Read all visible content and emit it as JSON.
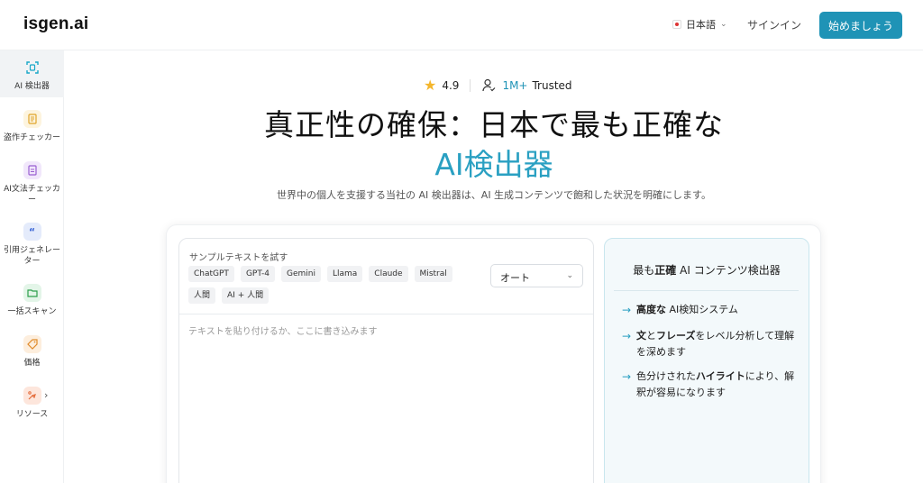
{
  "header": {
    "logo": "isgen.ai",
    "language": "日本語",
    "signin": "サインイン",
    "start": "始めましょう"
  },
  "sidebar": {
    "items": [
      {
        "label": "AI 検出器",
        "icon": "scan-icon",
        "color": "#19a7c8"
      },
      {
        "label": "盗作チェッカー",
        "icon": "document-icon",
        "color": "#e0a52a"
      },
      {
        "label": "AI文法チェッカー",
        "icon": "grammar-icon",
        "color": "#9a5fd1"
      },
      {
        "label": "引用ジェネレーター",
        "icon": "quote-icon",
        "color": "#3b66d6"
      },
      {
        "label": "一括スキャン",
        "icon": "folder-icon",
        "color": "#2d9f4c"
      },
      {
        "label": "価格",
        "icon": "tag-icon",
        "color": "#e08a2a"
      },
      {
        "label": "リソース",
        "icon": "resources-icon",
        "color": "#e46b3a"
      }
    ]
  },
  "hero": {
    "rating": "4.9",
    "trusted_count": "1M+",
    "trusted_label": "Trusted",
    "title_line1": "真正性の確保：日本で最も正確な",
    "title_line2": "AI検出器",
    "subtitle": "世界中の個人を支援する当社の AI 検出器は、AI 生成コンテンツで飽和した状況を明確にします。"
  },
  "editor": {
    "sample_title": "サンプルテキストを試す",
    "chips": [
      "ChatGPT",
      "GPT-4",
      "Gemini",
      "Llama",
      "Claude",
      "Mistral",
      "人間",
      "AI + 人間"
    ],
    "select_value": "オート",
    "placeholder": "テキストを貼り付けるか、ここに書き込みます"
  },
  "info": {
    "title_pre": "最も",
    "title_bold": "正確",
    "title_post": " AI コンテンツ検出器",
    "features": [
      {
        "bold": "高度な",
        "rest": " AI検知システム"
      },
      {
        "bold": "文",
        "mid": "と",
        "bold2": "フレーズ",
        "rest": "をレベル分析して理解を深めます"
      },
      {
        "pre": "色分けされた",
        "bold": "ハイライト",
        "rest": "により、解釈が容易になります"
      }
    ]
  },
  "colors": {
    "accent": "#1f93b6",
    "accent_light": "#2aa0c2",
    "star": "#f4b62c"
  }
}
